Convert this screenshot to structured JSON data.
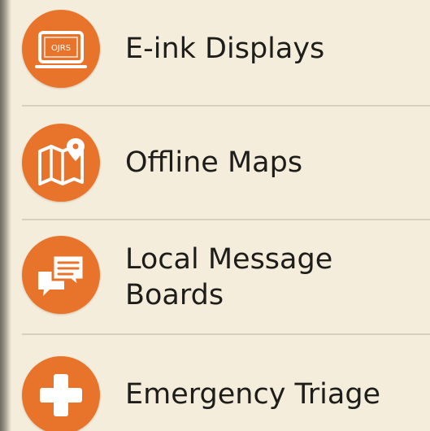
{
  "menu": {
    "items": [
      {
        "label": "E-ink Displays",
        "icon": "e-ink-display-icon",
        "screen_text": "OJRS"
      },
      {
        "label": "Offline Maps",
        "icon": "map-pin-icon"
      },
      {
        "label": "Local Message",
        "label_line2": "Boards",
        "icon": "message-boards-icon"
      },
      {
        "label": "Emergency Triage",
        "icon": "medical-cross-icon"
      }
    ]
  },
  "colors": {
    "background": "#f4eddc",
    "accent": "#e8742b",
    "text": "#1f1d1a",
    "divider": "#d8cfbd"
  }
}
